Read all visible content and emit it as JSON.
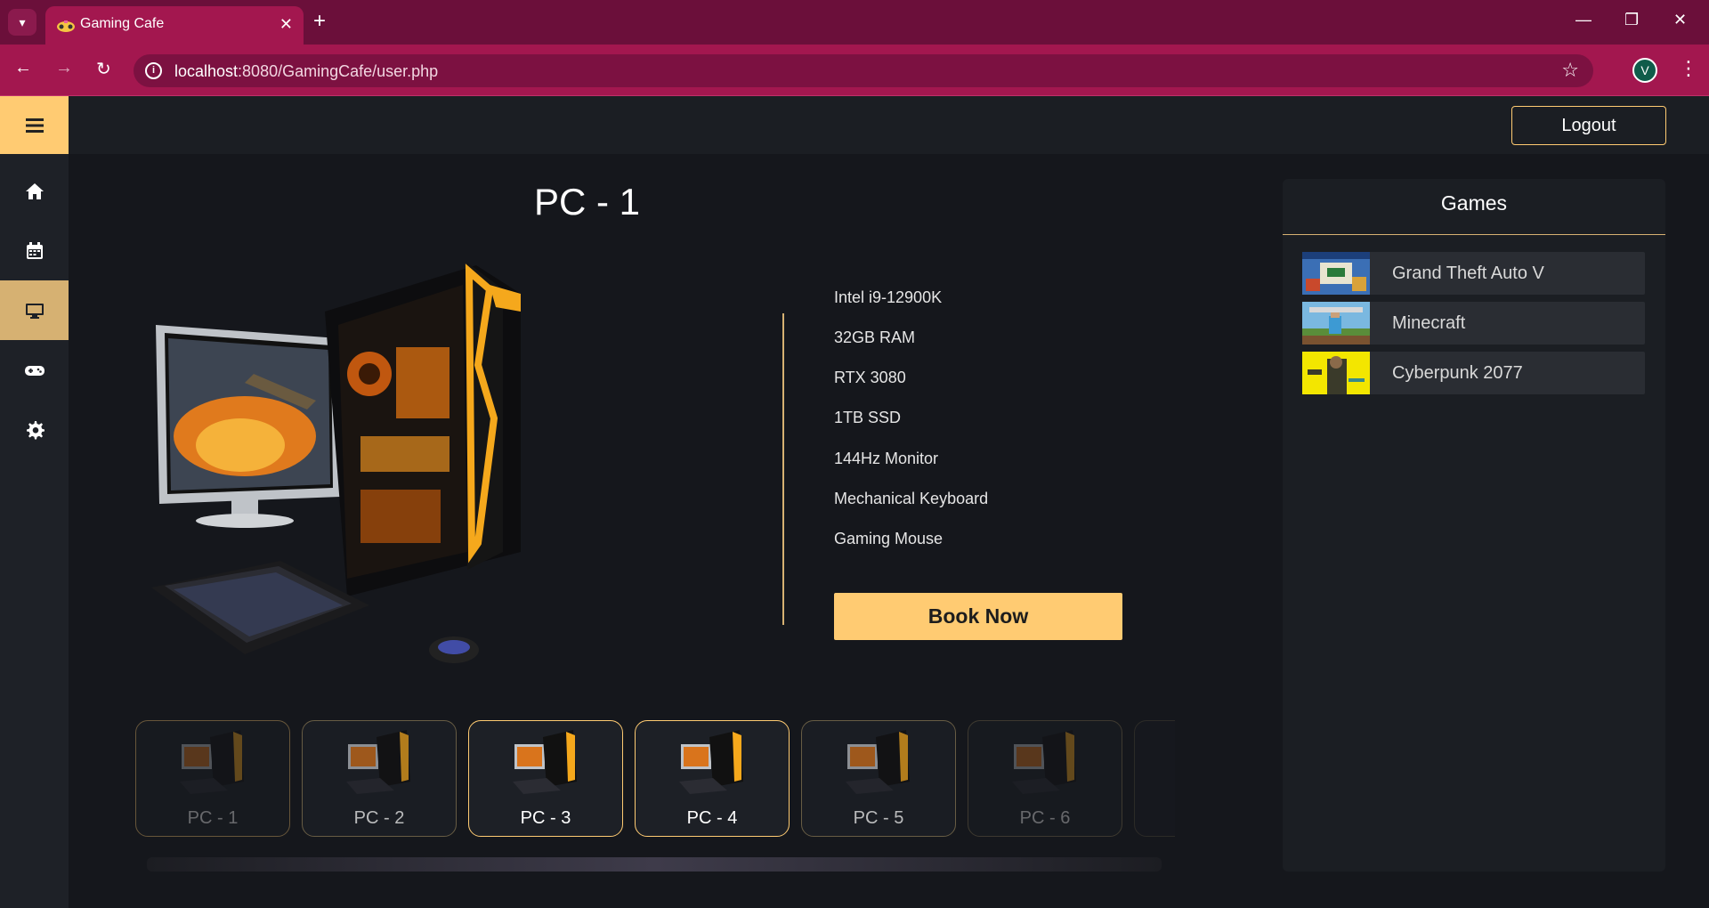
{
  "browser": {
    "tab_title": "Gaming Cafe",
    "url_host": "localhost",
    "url_rest": ":8080/GamingCafe/user.php",
    "profile_initial": "V"
  },
  "topbar": {
    "logout_label": "Logout"
  },
  "pc": {
    "title": "PC - 1",
    "specs": [
      "Intel i9-12900K",
      "32GB RAM",
      "RTX 3080",
      "1TB SSD",
      "144Hz Monitor",
      "Mechanical Keyboard",
      "Gaming Mouse"
    ],
    "book_label": "Book Now"
  },
  "thumbnails": [
    "PC - 1",
    "PC - 2",
    "PC - 3",
    "PC - 4",
    "PC - 5",
    "PC - 6"
  ],
  "games": {
    "title": "Games",
    "items": [
      "Grand Theft Auto V",
      "Minecraft",
      "Cyberpunk 2077"
    ]
  },
  "colors": {
    "accent": "#ffcb72",
    "browser": "#a3174f",
    "background": "#15171c"
  },
  "icons": [
    "menu-icon",
    "home-icon",
    "calendar-icon",
    "monitor-icon",
    "gamepad-icon",
    "gear-icon"
  ]
}
